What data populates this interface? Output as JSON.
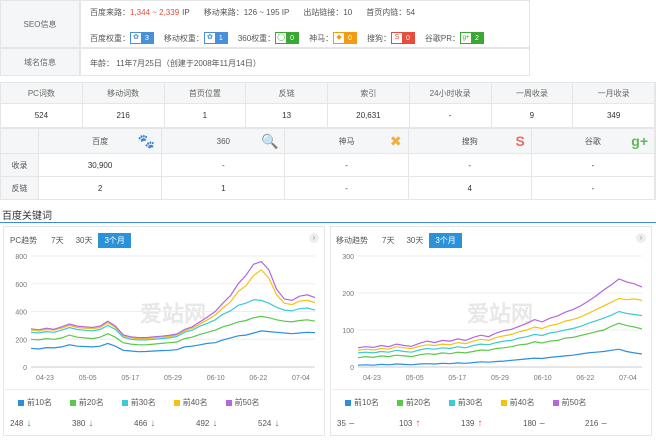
{
  "seo": {
    "label": "SEO信息",
    "baidu_source_label": "百度来路：",
    "baidu_source_value": "1,344 ~ 2,339",
    "baidu_source_unit": "IP",
    "mobile_source_label": "移动来路：",
    "mobile_source_value": "126 ~ 195 IP",
    "outbound_label": "出站链接：",
    "outbound_value": "10",
    "inbound_label": "首页内链：",
    "inbound_value": "54",
    "weights": [
      {
        "label": "百度权重：",
        "value": "3",
        "color": "#4a90d9"
      },
      {
        "label": "移动权重：",
        "value": "1",
        "color": "#4a90d9"
      },
      {
        "label": "360权重：",
        "value": "0",
        "color": "#3aa835"
      },
      {
        "label": "神马：",
        "value": "0",
        "color": "#f39c12"
      },
      {
        "label": "搜狗：",
        "value": "0",
        "color": "#e74c3c"
      },
      {
        "label": "谷歌PR：",
        "value": "2",
        "color": "#3aa835"
      }
    ]
  },
  "domain": {
    "label": "域名信息",
    "age_text": "年龄：  11年7月25日（创建于2008年11月14日）"
  },
  "stats": {
    "headers": [
      "PC词数",
      "移动词数",
      "首页位置",
      "反链",
      "索引",
      "24小时收录",
      "一周收录",
      "一月收录"
    ],
    "values": [
      "524",
      "216",
      "1",
      "13",
      "20,631",
      "-",
      "9",
      "349"
    ]
  },
  "engines": {
    "headers": [
      "百度",
      "360",
      "神马",
      "搜狗",
      "谷歌"
    ],
    "rows": [
      {
        "label": "收录",
        "values": [
          "30,900",
          "-",
          "-",
          "-",
          "-"
        ]
      },
      {
        "label": "反链",
        "values": [
          "2",
          "1",
          "-",
          "4",
          "-"
        ]
      }
    ]
  },
  "keywords_title": "百度关键词",
  "pc": {
    "title": "PC趋势",
    "tabs": [
      "7天",
      "30天",
      "3个月"
    ],
    "watermark": "爱站网",
    "legend": [
      "前10名",
      "前20名",
      "前30名",
      "前40名",
      "前50名"
    ],
    "counts": [
      {
        "value": "248",
        "dir": "↓"
      },
      {
        "value": "380",
        "dir": "↓"
      },
      {
        "value": "466",
        "dir": "↓"
      },
      {
        "value": "492",
        "dir": "↓"
      },
      {
        "value": "524",
        "dir": "↓"
      }
    ]
  },
  "mobile": {
    "title": "移动趋势",
    "tabs": [
      "7天",
      "30天",
      "3个月"
    ],
    "watermark": "爱站网",
    "legend": [
      "前10名",
      "前20名",
      "前30名",
      "前40名",
      "前50名"
    ],
    "counts": [
      {
        "value": "35",
        "dir": "–"
      },
      {
        "value": "103",
        "dir": "↑"
      },
      {
        "value": "139",
        "dir": "↑"
      },
      {
        "value": "180",
        "dir": "–"
      },
      {
        "value": "216",
        "dir": "–"
      }
    ]
  },
  "colors": {
    "series": [
      "#2a8fe0",
      "#5ac94a",
      "#3cc9d6",
      "#f5c211",
      "#b266e0"
    ],
    "accent": "#2a92d8"
  },
  "chart_data": [
    {
      "type": "line",
      "title": "PC趋势",
      "x_ticks": [
        "04-23",
        "05-05",
        "05-17",
        "05-29",
        "06-10",
        "06-22",
        "07-04"
      ],
      "ylim": [
        0,
        800
      ],
      "y_ticks": [
        0,
        200,
        400,
        600,
        800
      ],
      "series": [
        {
          "name": "前10名",
          "values": [
            135,
            130,
            140,
            138,
            145,
            160,
            150,
            148,
            145,
            150,
            170,
            150,
            120,
            115,
            110,
            112,
            115,
            118,
            120,
            125,
            145,
            150,
            160,
            170,
            175,
            195,
            210,
            225,
            230,
            245,
            260,
            255,
            250,
            245,
            240,
            245,
            250,
            248
          ]
        },
        {
          "name": "前20名",
          "values": [
            200,
            195,
            205,
            200,
            210,
            230,
            215,
            210,
            205,
            215,
            240,
            215,
            175,
            165,
            160,
            160,
            165,
            170,
            175,
            180,
            205,
            215,
            235,
            250,
            265,
            290,
            305,
            325,
            335,
            355,
            365,
            355,
            340,
            330,
            325,
            335,
            340,
            330
          ]
        },
        {
          "name": "前30名",
          "values": [
            250,
            245,
            255,
            250,
            265,
            285,
            270,
            265,
            260,
            270,
            300,
            270,
            215,
            200,
            195,
            195,
            200,
            205,
            210,
            220,
            250,
            265,
            295,
            315,
            340,
            380,
            405,
            445,
            460,
            485,
            480,
            460,
            430,
            410,
            405,
            420,
            425,
            410
          ]
        },
        {
          "name": "前40名",
          "values": [
            265,
            258,
            270,
            265,
            280,
            300,
            285,
            280,
            275,
            285,
            320,
            285,
            225,
            210,
            205,
            205,
            210,
            215,
            220,
            230,
            260,
            280,
            310,
            340,
            375,
            425,
            470,
            545,
            585,
            660,
            700,
            640,
            520,
            460,
            450,
            475,
            480,
            465
          ]
        },
        {
          "name": "前50名",
          "values": [
            275,
            268,
            280,
            272,
            290,
            310,
            295,
            290,
            285,
            295,
            330,
            295,
            232,
            218,
            212,
            212,
            218,
            222,
            228,
            238,
            270,
            290,
            325,
            360,
            400,
            460,
            515,
            600,
            660,
            740,
            760,
            700,
            560,
            490,
            480,
            510,
            520,
            500
          ]
        }
      ]
    },
    {
      "type": "line",
      "title": "移动趋势",
      "x_ticks": [
        "04-23",
        "05-05",
        "05-17",
        "05-29",
        "06-10",
        "06-22",
        "07-04"
      ],
      "ylim": [
        0,
        300
      ],
      "y_ticks": [
        0,
        100,
        200,
        300
      ],
      "series": [
        {
          "name": "前10名",
          "values": [
            5,
            6,
            5,
            7,
            6,
            8,
            7,
            6,
            8,
            9,
            8,
            10,
            9,
            11,
            10,
            12,
            14,
            13,
            15,
            16,
            18,
            20,
            22,
            24,
            23,
            26,
            28,
            30,
            32,
            35,
            38,
            40,
            42,
            45,
            48,
            42,
            38,
            35
          ]
        },
        {
          "name": "前20名",
          "values": [
            25,
            28,
            26,
            30,
            28,
            32,
            30,
            28,
            33,
            36,
            34,
            38,
            36,
            40,
            38,
            42,
            46,
            45,
            50,
            52,
            55,
            60,
            62,
            68,
            65,
            70,
            72,
            78,
            80,
            85,
            90,
            95,
            100,
            110,
            118,
            112,
            108,
            103
          ]
        },
        {
          "name": "前30名",
          "values": [
            38,
            40,
            38,
            42,
            40,
            45,
            42,
            40,
            46,
            50,
            48,
            52,
            50,
            55,
            52,
            58,
            62,
            60,
            66,
            70,
            72,
            78,
            82,
            88,
            85,
            92,
            95,
            100,
            104,
            110,
            118,
            125,
            132,
            140,
            150,
            145,
            142,
            139
          ]
        },
        {
          "name": "前40名",
          "values": [
            45,
            48,
            46,
            50,
            48,
            55,
            52,
            50,
            56,
            60,
            58,
            62,
            60,
            66,
            63,
            70,
            75,
            72,
            80,
            84,
            88,
            95,
            100,
            108,
            104,
            112,
            116,
            124,
            128,
            135,
            145,
            155,
            165,
            175,
            185,
            182,
            184,
            180
          ]
        },
        {
          "name": "前50名",
          "values": [
            52,
            55,
            53,
            58,
            55,
            62,
            58,
            56,
            64,
            70,
            66,
            72,
            70,
            76,
            72,
            80,
            86,
            82,
            92,
            98,
            102,
            110,
            118,
            128,
            122,
            132,
            138,
            148,
            155,
            165,
            178,
            192,
            208,
            222,
            238,
            230,
            225,
            216
          ]
        }
      ]
    }
  ]
}
